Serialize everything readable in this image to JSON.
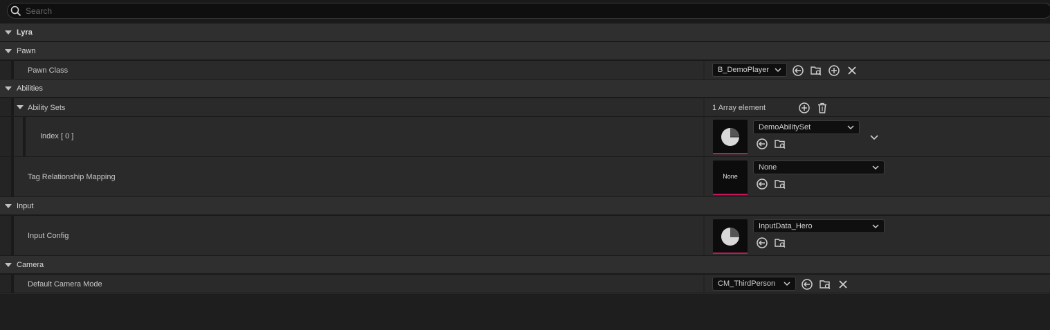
{
  "search": {
    "placeholder": "Search"
  },
  "categories": {
    "lyra": "Lyra",
    "pawn": "Pawn",
    "abilities": "Abilities",
    "input": "Input",
    "camera": "Camera"
  },
  "properties": {
    "pawn_class": {
      "label": "Pawn Class",
      "value": "B_DemoPlayer"
    },
    "ability_sets": {
      "label": "Ability Sets",
      "count_text": "1 Array element"
    },
    "index0": {
      "label": "Index [ 0 ]",
      "value": "DemoAbilitySet"
    },
    "tag_mapping": {
      "label": "Tag Relationship Mapping",
      "value": "None",
      "thumb_text": "None"
    },
    "input_config": {
      "label": "Input Config",
      "value": "InputData_Hero"
    },
    "camera_mode": {
      "label": "Default Camera Mode",
      "value": "CM_ThirdPerson"
    }
  },
  "colors": {
    "accent": "#c2185b",
    "background": "#1a1a1a",
    "row": "#2a2a2a",
    "category": "#2f2f2f"
  }
}
